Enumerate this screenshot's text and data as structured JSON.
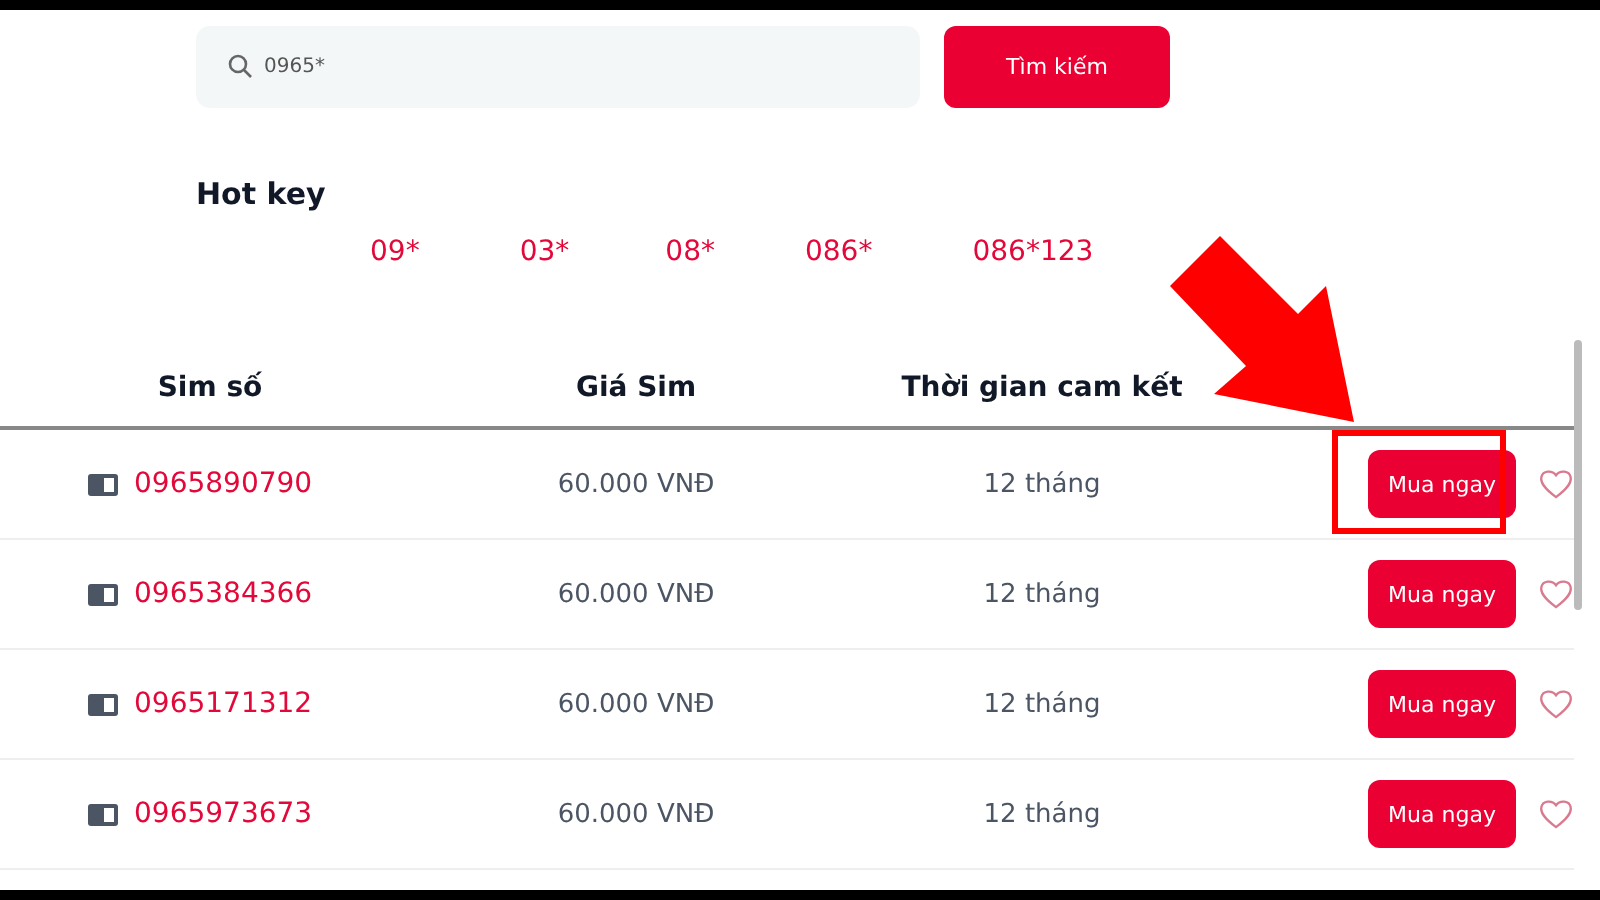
{
  "search": {
    "value": "0965*",
    "button": "Tìm kiếm"
  },
  "hot_key": {
    "title": "Hot key",
    "keys": [
      "09*",
      "03*",
      "08*",
      "086*",
      "086*123"
    ]
  },
  "table": {
    "columns": [
      "Sim số",
      "Giá Sim",
      "Thời gian cam kết"
    ],
    "rows": [
      {
        "number": "0965890790",
        "price": "60.000 VNĐ",
        "term": "12 tháng",
        "button": "Mua ngay",
        "highlighted": true
      },
      {
        "number": "0965384366",
        "price": "60.000 VNĐ",
        "term": "12 tháng",
        "button": "Mua ngay",
        "highlighted": false
      },
      {
        "number": "0965171312",
        "price": "60.000 VNĐ",
        "term": "12 tháng",
        "button": "Mua ngay",
        "highlighted": false
      },
      {
        "number": "0965973673",
        "price": "60.000 VNĐ",
        "term": "12 tháng",
        "button": "Mua ngay",
        "highlighted": false
      }
    ]
  }
}
